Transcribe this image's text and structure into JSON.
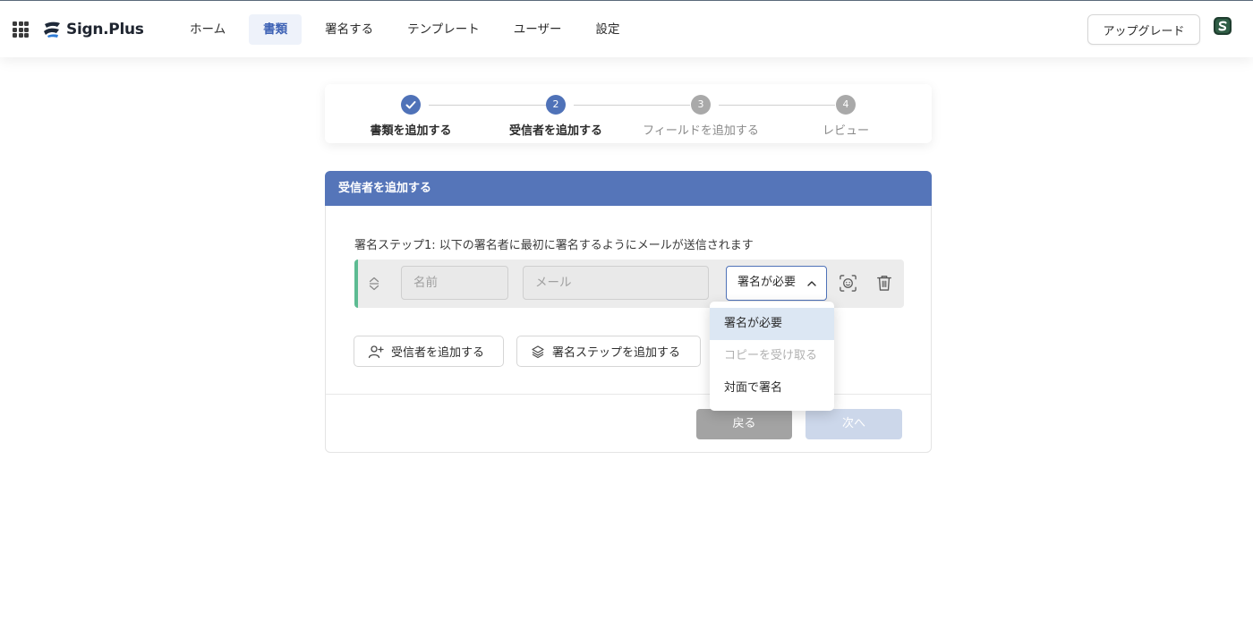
{
  "app": {
    "logo_text": "Sign.Plus",
    "logo_icon": "sign-plus-logo-icon",
    "apps_icon": "grid-apps-icon"
  },
  "nav": {
    "items": [
      {
        "label": "ホーム",
        "active": false
      },
      {
        "label": "書類",
        "active": true
      },
      {
        "label": "署名する",
        "active": false
      },
      {
        "label": "テンプレート",
        "active": false
      },
      {
        "label": "ユーザー",
        "active": false
      },
      {
        "label": "設定",
        "active": false
      }
    ],
    "upgrade_label": "アップグレード",
    "avatar_icon": "user-avatar-icon"
  },
  "stepper": {
    "steps": [
      {
        "number": "1",
        "label": "書類を追加する",
        "state": "done"
      },
      {
        "number": "2",
        "label": "受信者を追加する",
        "state": "current"
      },
      {
        "number": "3",
        "label": "フィールドを追加する",
        "state": "future"
      },
      {
        "number": "4",
        "label": "レビュー",
        "state": "future"
      }
    ]
  },
  "panel": {
    "header": "受信者を追加する",
    "step_description": "署名ステップ1: 以下の署名者に最初に署名するようにメールが送信されます",
    "recipient": {
      "name_placeholder": "名前",
      "email_placeholder": "メール",
      "role_value": "署名が必要",
      "role_chevron": "chevron-up-icon",
      "face_icon": "face-scan-icon",
      "delete_icon": "trash-icon",
      "drag_icon": "drag-handle-icon"
    },
    "add_recipient_label": "受信者を追加する",
    "add_step_label": "署名ステップを追加する",
    "back_label": "戻る",
    "next_label": "次へ"
  },
  "dropdown": {
    "options": [
      {
        "label": "署名が必要",
        "selected": true,
        "disabled": false
      },
      {
        "label": "コピーを受け取る",
        "selected": false,
        "disabled": true
      },
      {
        "label": "対面で署名",
        "selected": false,
        "disabled": false
      }
    ]
  },
  "colors": {
    "accent": "#4f72b8",
    "header_bg": "#5575b9",
    "row_marker": "#5dbb92"
  }
}
